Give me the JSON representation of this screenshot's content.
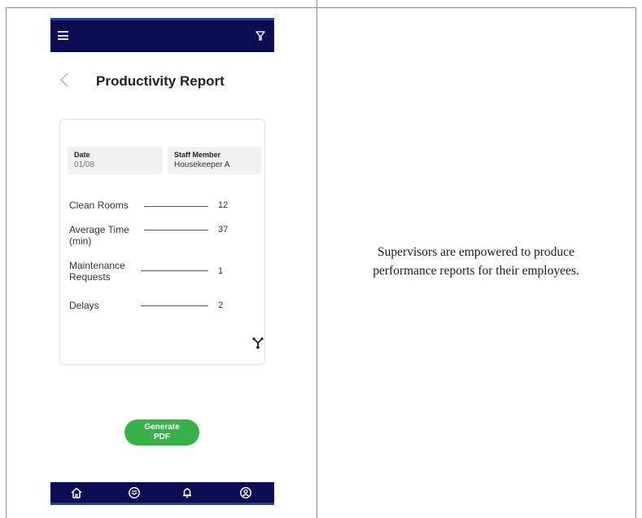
{
  "app": {
    "title": "Productivity Report"
  },
  "report": {
    "date_label": "Date",
    "date_value": "01/08",
    "staff_label": "Staff Member",
    "staff_value": "Housekeeper A",
    "stats": [
      {
        "label": "Clean Rooms",
        "value": "12"
      },
      {
        "label": "Average Time (min)",
        "value": "37"
      },
      {
        "label": "Maintenance Requests",
        "value": "1"
      },
      {
        "label": "Delays",
        "value": "2"
      }
    ]
  },
  "actions": {
    "generate_line1": "Generate",
    "generate_line2": "PDF"
  },
  "caption": {
    "line1": "Supervisors are empowered to produce",
    "line2": "performance reports for their employees."
  },
  "nav": {
    "items": [
      "home-icon",
      "inbox-icon",
      "bell-icon",
      "profile-icon"
    ]
  },
  "colors": {
    "bar": "#0c0c52",
    "accent_button": "#3ab04a"
  }
}
